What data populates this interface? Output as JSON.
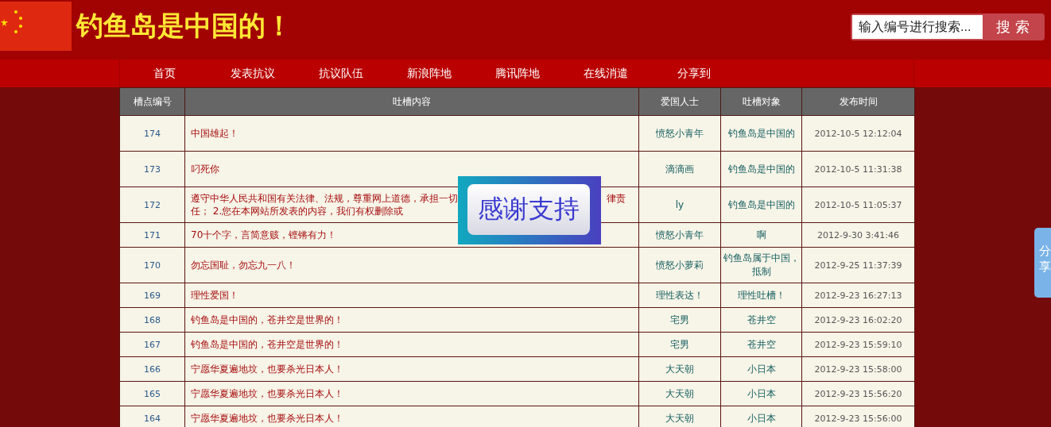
{
  "header": {
    "title": "钓鱼岛是中国的！",
    "search": {
      "placeholder": "输入编号进行搜索...",
      "button": "搜 索"
    }
  },
  "nav": [
    "首页",
    "发表抗议",
    "抗议队伍",
    "新浪阵地",
    "腾讯阵地",
    "在线消遣",
    "分享到"
  ],
  "table": {
    "columns": [
      "槽点编号",
      "吐槽内容",
      "爱国人士",
      "吐槽对象",
      "发布时间"
    ],
    "rows": [
      {
        "number": "174",
        "content_lines": [
          [
            "中国雄起！"
          ]
        ],
        "author": "愤怒小青年",
        "target": "钓鱼岛是中国的",
        "time": "2012-10-5 12:12:04"
      },
      {
        "number": "173",
        "content_lines": [
          [
            "叼死你"
          ]
        ],
        "author": "滴滴画",
        "target": "钓鱼岛是中国的",
        "time": "2012-10-5 11:31:38"
      },
      {
        "number": "172",
        "content_lines": [
          [
            "遵守中华人民共和国有关法律、法规，尊重网上道德，承担一切",
            "律责"
          ],
          [
            "任；  2.您在本网站所发表的内容，我们有权删除或"
          ]
        ],
        "author": "ly",
        "target": "钓鱼岛是中国的",
        "time": "2012-10-5 11:05:37"
      },
      {
        "number": "171",
        "content_lines": [
          [
            "70十个字，言简意赅，铿锵有力！"
          ]
        ],
        "author": "愤怒小青年",
        "target": "啊",
        "time": "2012-9-30 3:41:46"
      },
      {
        "number": "170",
        "content_lines": [
          [
            "勿忘国耻，勿忘九一八！"
          ]
        ],
        "author": "愤怒小萝莉",
        "target": "钓鱼岛属于中国，抵制",
        "time": "2012-9-25 11:37:39"
      },
      {
        "number": "169",
        "content_lines": [
          [
            "理性爱国！"
          ]
        ],
        "author": "理性表达！",
        "target": "理性吐槽！",
        "time": "2012-9-23 16:27:13"
      },
      {
        "number": "168",
        "content_lines": [
          [
            "钓鱼岛是中国的，苍井空是世界的！"
          ]
        ],
        "author": "宅男",
        "target": "苍井空",
        "time": "2012-9-23 16:02:20"
      },
      {
        "number": "167",
        "content_lines": [
          [
            "钓鱼岛是中国的，苍井空是世界的！"
          ]
        ],
        "author": "宅男",
        "target": "苍井空",
        "time": "2012-9-23 15:59:10"
      },
      {
        "number": "166",
        "content_lines": [
          [
            "宁愿华夏遍地坟，也要杀光日本人！"
          ]
        ],
        "author": "大天朝",
        "target": "小日本",
        "time": "2012-9-23 15:58:00"
      },
      {
        "number": "165",
        "content_lines": [
          [
            "宁愿华夏遍地坟，也要杀光日本人！"
          ]
        ],
        "author": "大天朝",
        "target": "小日本",
        "time": "2012-9-23 15:56:20"
      },
      {
        "number": "164",
        "content_lines": [
          [
            "宁愿华夏遍地坟，也要杀光日本人！"
          ]
        ],
        "author": "大天朝",
        "target": "小日本",
        "time": "2012-9-23 15:56:00"
      }
    ]
  },
  "popup": {
    "text": "感谢支持"
  },
  "share_tab": {
    "text": "分享"
  }
}
